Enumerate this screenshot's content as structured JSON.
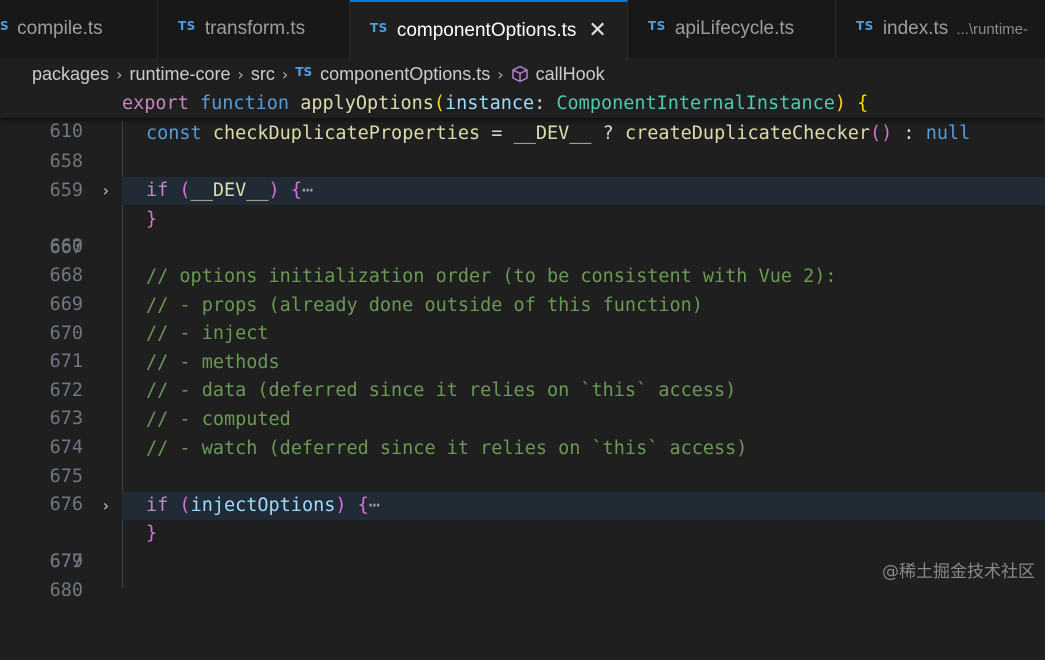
{
  "tabs": [
    {
      "icon": "TS",
      "label": "compile.ts"
    },
    {
      "icon": "TS",
      "label": "transform.ts"
    },
    {
      "icon": "TS",
      "label": "componentOptions.ts",
      "close": "✕"
    },
    {
      "icon": "TS",
      "label": "apiLifecycle.ts"
    },
    {
      "icon": "TS",
      "label": "index.ts",
      "desc": "...\\runtime-"
    }
  ],
  "first_tab_visible_text": "S",
  "breadcrumb": {
    "items": [
      "packages",
      "runtime-core",
      "src",
      "componentOptions.ts",
      "callHook"
    ],
    "file_icon": "TS",
    "separator": "›"
  },
  "editor": {
    "sticky": {
      "number": "610",
      "tokens": [
        "export",
        "function",
        "applyOptions",
        "(",
        "instance",
        ": ",
        "ComponentInternalInstance",
        ") ",
        "{"
      ]
    },
    "lines": [
      {
        "number": "658",
        "tokens": [
          "const",
          "checkDuplicateProperties",
          " = ",
          "__DEV__",
          " ? ",
          "createDuplicateChecker",
          "()",
          " : ",
          "null"
        ]
      },
      {
        "number": "659"
      },
      {
        "number": "660",
        "tokens": [
          "if",
          " (",
          "__DEV__",
          ") ",
          "{",
          "⋯"
        ]
      },
      {
        "number": "667",
        "tokens": [
          "}"
        ]
      },
      {
        "number": "668"
      },
      {
        "number": "669",
        "text": "// options initialization order (to be consistent with Vue 2):"
      },
      {
        "number": "670",
        "text": "// - props (already done outside of this function)"
      },
      {
        "number": "671",
        "text": "// - inject"
      },
      {
        "number": "672",
        "text": "// - methods"
      },
      {
        "number": "673",
        "text": "// - data (deferred since it relies on `this` access)"
      },
      {
        "number": "674",
        "text": "// - computed"
      },
      {
        "number": "675",
        "text": "// - watch (deferred since it relies on `this` access)"
      },
      {
        "number": "676"
      },
      {
        "number": "677",
        "tokens": [
          "if",
          " (",
          "injectOptions",
          ") ",
          "{",
          "⋯"
        ]
      },
      {
        "number": "679",
        "tokens": [
          "}"
        ]
      },
      {
        "number": "680"
      }
    ],
    "fold_icon": "›"
  },
  "watermark": "@稀土掘金技术社区",
  "colors": {
    "background": "#1f1f1f",
    "tab_bar": "#181818",
    "active_tab_border": "#0078d4",
    "keyword": "#569cd6",
    "control": "#c586c0",
    "function": "#dcdcaa",
    "variable": "#9cdcfe",
    "type": "#4ec9b0",
    "comment": "#6a9955",
    "line_number": "#6e7681",
    "highlight_line": "#212b35"
  }
}
